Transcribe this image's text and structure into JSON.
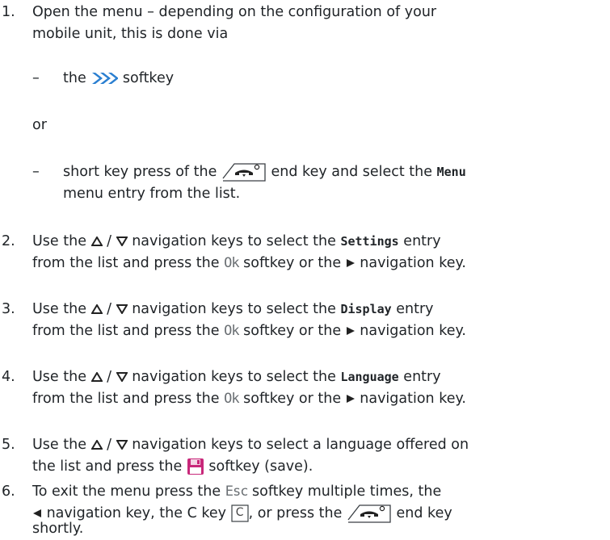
{
  "steps": [
    {
      "num": "1.",
      "line1": "Open the menu – depending on the configuration of your",
      "line2": "mobile unit, this is done via",
      "opt1_dash": "–",
      "opt1_pre": "the",
      "opt1_post": "softkey",
      "or": "or",
      "opt2_dash": "–",
      "opt2_pre": "short key press of the",
      "opt2_mid": "end key and select the",
      "opt2_menu": "Menu",
      "opt2_line2": "menu entry from the list."
    },
    {
      "num": "2.",
      "use": "Use the",
      "slash": "/",
      "nav": "navigation keys to select the",
      "entry": "Settings",
      "entry_post": "entry",
      "l2_pre": "from the list and press the",
      "ok": "Ok",
      "l2_mid": "softkey or the",
      "l2_post": "navigation key."
    },
    {
      "num": "3.",
      "use": "Use the",
      "slash": "/",
      "nav": "navigation keys to select the",
      "entry": "Display",
      "entry_post": "entry",
      "l2_pre": "from the list and press the",
      "ok": "Ok",
      "l2_mid": "softkey or the",
      "l2_post": "navigation key."
    },
    {
      "num": "4.",
      "use": "Use the",
      "slash": "/",
      "nav": "navigation keys to select the",
      "entry": "Language",
      "entry_post": "entry",
      "l2_pre": "from the list and press the",
      "ok": "Ok",
      "l2_mid": "softkey or the",
      "l2_post": "navigation key."
    },
    {
      "num": "5.",
      "use": "Use the",
      "slash": "/",
      "nav": "navigation keys to select a language offered on",
      "l2_pre": "the list and press the",
      "l2_post": "softkey (save)."
    },
    {
      "num": "6.",
      "line1_pre": "To exit the menu press the",
      "esc": "Esc",
      "line1_post": "softkey multiple times, the",
      "l2_a": "navigation key, the C key",
      "ckey": "C",
      "l2_b": ", or press the",
      "l2_c": "end key",
      "line3": "shortly."
    }
  ],
  "icons": {
    "menu_softkey": "double-chevron-right-icon",
    "end_key": "phone-end-key-icon",
    "nav_up": "triangle-up-icon",
    "nav_down": "triangle-down-icon",
    "nav_right": "triangle-right-icon",
    "nav_left": "triangle-left-icon",
    "save": "floppy-disk-icon"
  },
  "colors": {
    "text": "#1f2327",
    "accent_blue": "#2a7fd1",
    "save_magenta": "#c8287a",
    "lcd_grey": "#6a6f73"
  }
}
